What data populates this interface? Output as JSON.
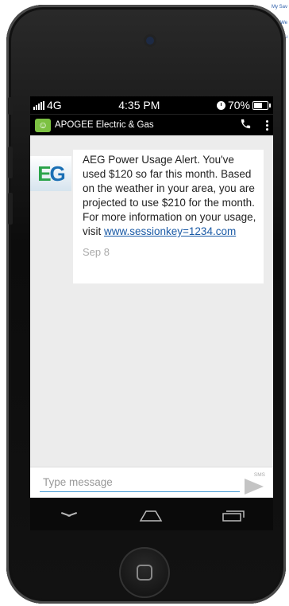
{
  "background_page": {
    "link1": "My Sav",
    "link2": "We",
    "link3": "u"
  },
  "status_bar": {
    "network": "4G",
    "time": "4:35 PM",
    "battery": "70%",
    "battery_level": 0.7
  },
  "app_bar": {
    "title": "APOGEE Electric & Gas"
  },
  "message": {
    "avatar_text": "EG",
    "text": "AEG Power Usage Alert. You've used $120 so far this month. Based on the weather in your area, you are projected to use $210 for the month. For more information on your usage, visit ",
    "link": "www.sessionkey=1234.com",
    "date": "Sep 8"
  },
  "compose": {
    "placeholder": "Type message",
    "send_label": "SMS"
  },
  "colors": {
    "accent_link": "#1a5aa6",
    "app_icon": "#7cc142"
  }
}
